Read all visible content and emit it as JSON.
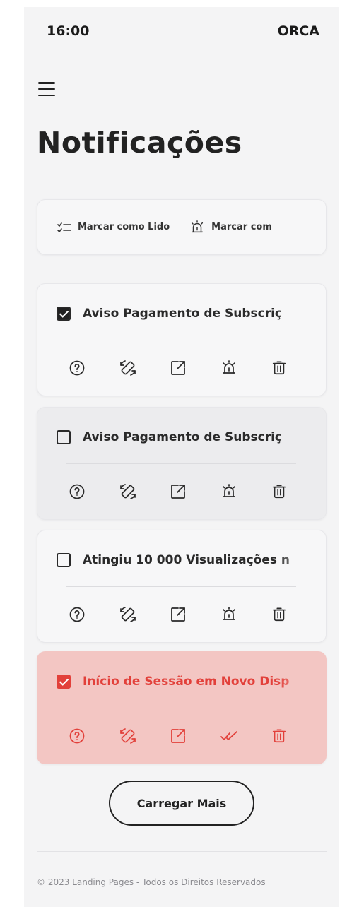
{
  "status_bar": {
    "time": "16:00",
    "carrier": "ORCA"
  },
  "page_title": "Notificações",
  "bulk_actions": [
    {
      "label": "Marcar como Lido",
      "icon": "list-check-icon"
    },
    {
      "label": "Marcar com",
      "icon": "alarm-icon"
    }
  ],
  "notifications": [
    {
      "title": "Aviso Pagamento de Subscriç",
      "checked": true,
      "highlighted": false,
      "icons": [
        "help-icon",
        "rotate-icon",
        "open-external-icon",
        "alarm-icon",
        "trash-icon"
      ]
    },
    {
      "title": "Aviso Pagamento de Subscriç",
      "checked": false,
      "highlighted": false,
      "icons": [
        "help-icon",
        "rotate-icon",
        "open-external-icon",
        "alarm-icon",
        "trash-icon"
      ]
    },
    {
      "title": "Atingiu 10 000 Visualizações n",
      "checked": false,
      "highlighted": false,
      "icons": [
        "help-icon",
        "rotate-icon",
        "open-external-icon",
        "alarm-icon",
        "trash-icon"
      ]
    },
    {
      "title": "Início de Sessão em Novo Disp",
      "checked": true,
      "highlighted": true,
      "icons": [
        "help-icon",
        "rotate-icon",
        "open-external-icon",
        "double-check-icon",
        "trash-icon"
      ]
    }
  ],
  "load_more_label": "Carregar Mais",
  "footer_text": "© 2023 Landing Pages - Todos os Direitos Reservados",
  "colors": {
    "accent": "#e2403a",
    "highlight_bg": "#f3c6c3",
    "screen_bg": "#f4f4f5"
  }
}
